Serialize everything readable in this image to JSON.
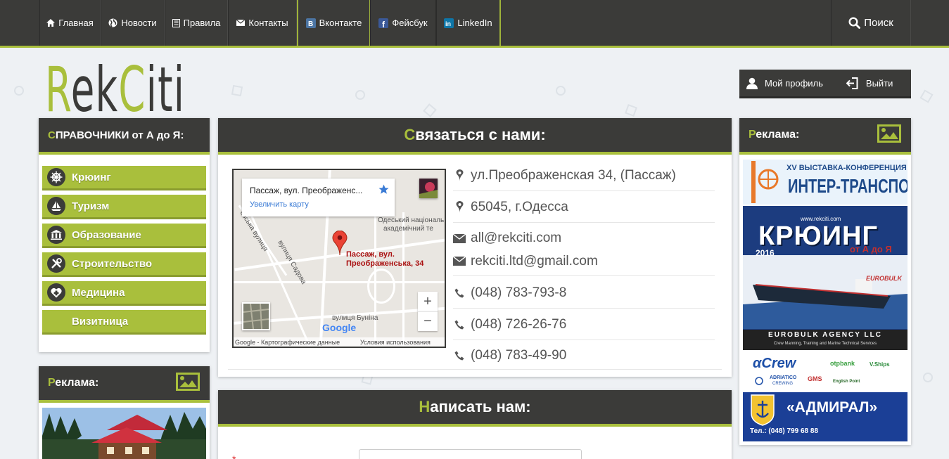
{
  "nav": {
    "items": [
      {
        "label": "Главная",
        "icon": "home-icon"
      },
      {
        "label": "Новости",
        "icon": "globe-icon"
      },
      {
        "label": "Правила",
        "icon": "book-icon"
      },
      {
        "label": "Контакты",
        "icon": "envelope-icon"
      }
    ],
    "social": [
      {
        "label": "Вконтакте",
        "icon": "vk-icon"
      },
      {
        "label": "Фейсбук",
        "icon": "facebook-icon"
      },
      {
        "label": "LinkedIn",
        "icon": "linkedin-icon"
      }
    ],
    "search_label": "Поиск"
  },
  "logo": {
    "part1": "R",
    "part2": "ek",
    "part3": "C",
    "part4": "iti"
  },
  "user": {
    "profile_label": "Мой профиль",
    "logout_label": "Выйти"
  },
  "catalog": {
    "title_first": "С",
    "title_rest": "ПРАВОЧНИКИ от А до Я:",
    "items": [
      {
        "label": "Крюинг",
        "icon": "ship-wheel-icon"
      },
      {
        "label": "Туризм",
        "icon": "sailboat-icon"
      },
      {
        "label": "Образование",
        "icon": "school-icon"
      },
      {
        "label": "Строительство",
        "icon": "tools-icon"
      },
      {
        "label": "Медицина",
        "icon": "medical-heart-icon"
      },
      {
        "label": "Визитница",
        "icon": ""
      }
    ]
  },
  "left_ad": {
    "title_first": "Р",
    "title_rest": "еклама:"
  },
  "right_ad": {
    "title_first": "Р",
    "title_rest": "еклама:"
  },
  "contact": {
    "title_first": "С",
    "title_rest": "вязаться с нами:",
    "address": "ул.Преображенская 34, (Пассаж)",
    "city": "65045, г.Одесса",
    "emails": [
      "all@rekciti.com",
      "rekciti.ltd@gmail.com"
    ],
    "phones": [
      "(048) 783-793-8",
      "(048) 726-26-76",
      "(048) 783-49-90"
    ]
  },
  "map": {
    "card_title": "Пассаж, вул. Преображенс...",
    "card_link": "Увеличить карту",
    "marker_label_1": "Пассаж, вул.",
    "marker_label_2": "Преображенська, 34",
    "street_1": "вулиця Садова",
    "street_2": "євська вулиця",
    "street_3": "вулиця Буніна",
    "poi_1": "Одеський національ",
    "poi_2": "академічний те",
    "logo": "Google",
    "footer_left": "Google - Картографические данные",
    "footer_right": "Условия использования"
  },
  "write": {
    "title_first": "Н",
    "title_rest": "аписать нам:",
    "required_mark": "*"
  },
  "ads": {
    "inter": {
      "line1": "XV ВЫСТАВКА-КОНФЕРЕНЦИЯ",
      "line2": "ИНТЕР-ТРАНСПОРТ"
    },
    "crewing": {
      "site": "www.rekciti.com",
      "title": "КРЮИНГ",
      "year": "2016",
      "sub": "от А до Я",
      "brand": "EUROBULK"
    },
    "eurobulk": {
      "title": "EUROBULK AGENCY LLC",
      "sub": "Crew Manning, Training and Marine Technical Services"
    },
    "logos": {
      "alpha": "Crew",
      "otp": "otpbank",
      "vships": "V.Ships",
      "adriatico": "ADRIATICO",
      "adriatico_sub": "CREWING",
      "gms": "GMS",
      "english": "English Point"
    },
    "admiral": {
      "title": "«АДМИРАЛ»",
      "phone": "Тел.: (048) 799 68 88"
    }
  }
}
